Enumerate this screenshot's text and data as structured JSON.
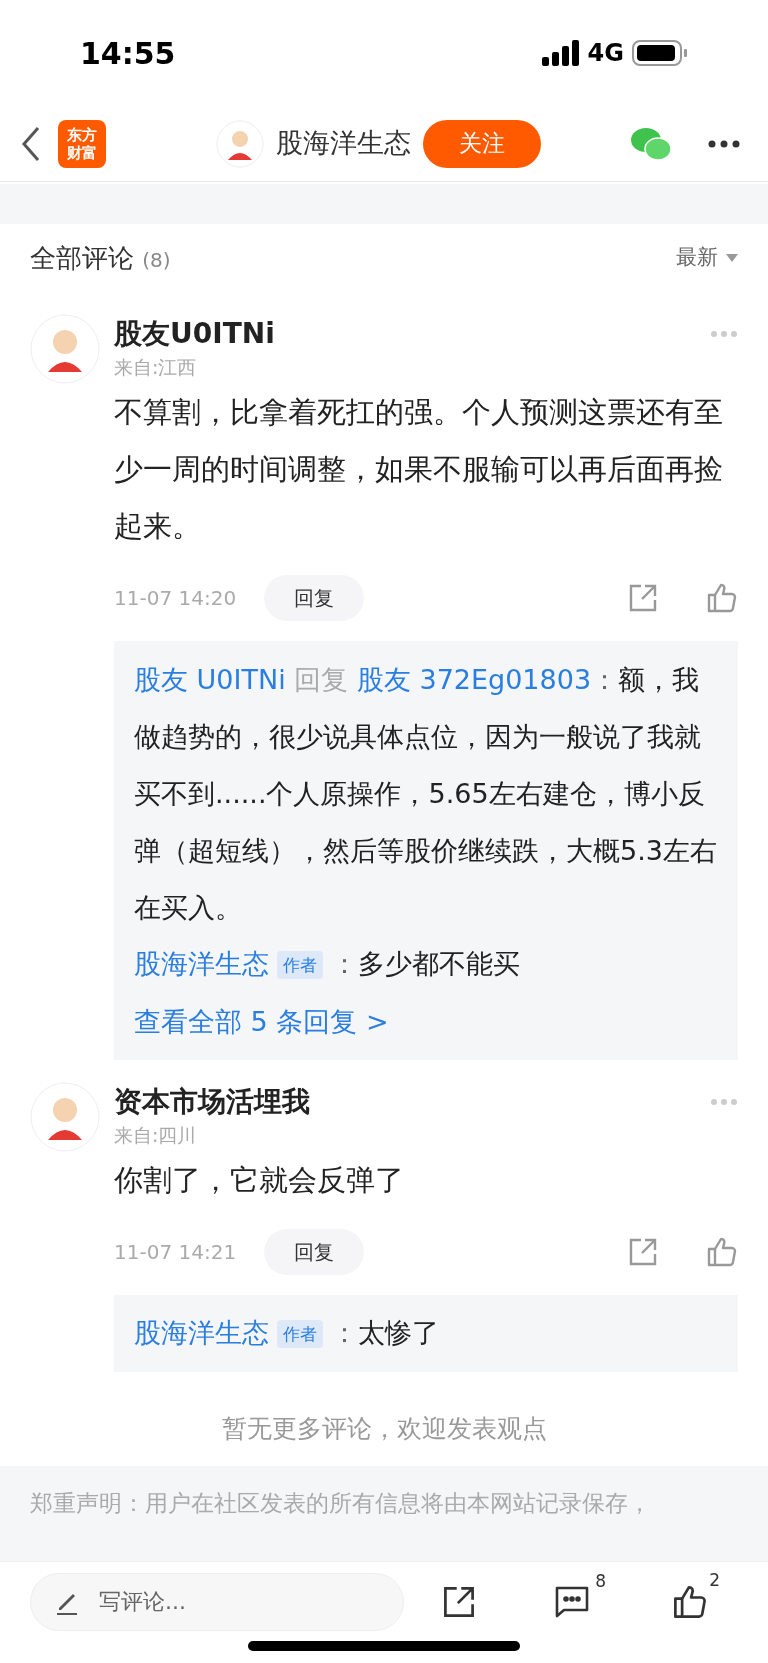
{
  "status_bar": {
    "time": "14:55",
    "network": "4G"
  },
  "nav": {
    "logo_lines": [
      "东方",
      "财富"
    ],
    "title": "股海洋生态",
    "follow_button": "关注"
  },
  "comments_header": {
    "title": "全部评论",
    "count": "(8)",
    "sort": "最新"
  },
  "comments": [
    {
      "user": "股友U0ITNi",
      "location": "来自:江西",
      "body": "不算割，比拿着死扛的强。个人预测这票还有至少一周的时间调整，如果不服输可以再后面再捡起来。",
      "time": "11-07 14:20",
      "reply_button": "回复",
      "replies": [
        {
          "kind": "reply_to",
          "author": "股友 U0ITNi",
          "verb": "回复",
          "target": "股友 372Eg01803",
          "separator": "：",
          "text": "额，我做趋势的，很少说具体点位，因为一般说了我就买不到......个人原操作，5.65左右建仓，博小反弹（超短线），然后等股价继续跌，大概5.3左右在买入。"
        },
        {
          "kind": "author_reply",
          "author": "股海洋生态",
          "badge": "作者",
          "separator": "：",
          "text": "多少都不能买"
        }
      ],
      "more_link": "查看全部 5 条回复 >"
    },
    {
      "user": "资本市场活埋我",
      "location": "来自:四川",
      "body": "你割了，它就会反弹了",
      "time": "11-07 14:21",
      "reply_button": "回复",
      "replies": [
        {
          "kind": "author_reply",
          "author": "股海洋生态",
          "badge": "作者",
          "separator": "：",
          "text": "太惨了"
        }
      ]
    }
  ],
  "end_note": "暂无更多评论，欢迎发表观点",
  "disclaimer": "郑重声明：用户在社区发表的所有信息将由本网站记录保存，",
  "bottom_bar": {
    "placeholder": "写评论...",
    "comment_count": "8",
    "like_count": "2"
  }
}
